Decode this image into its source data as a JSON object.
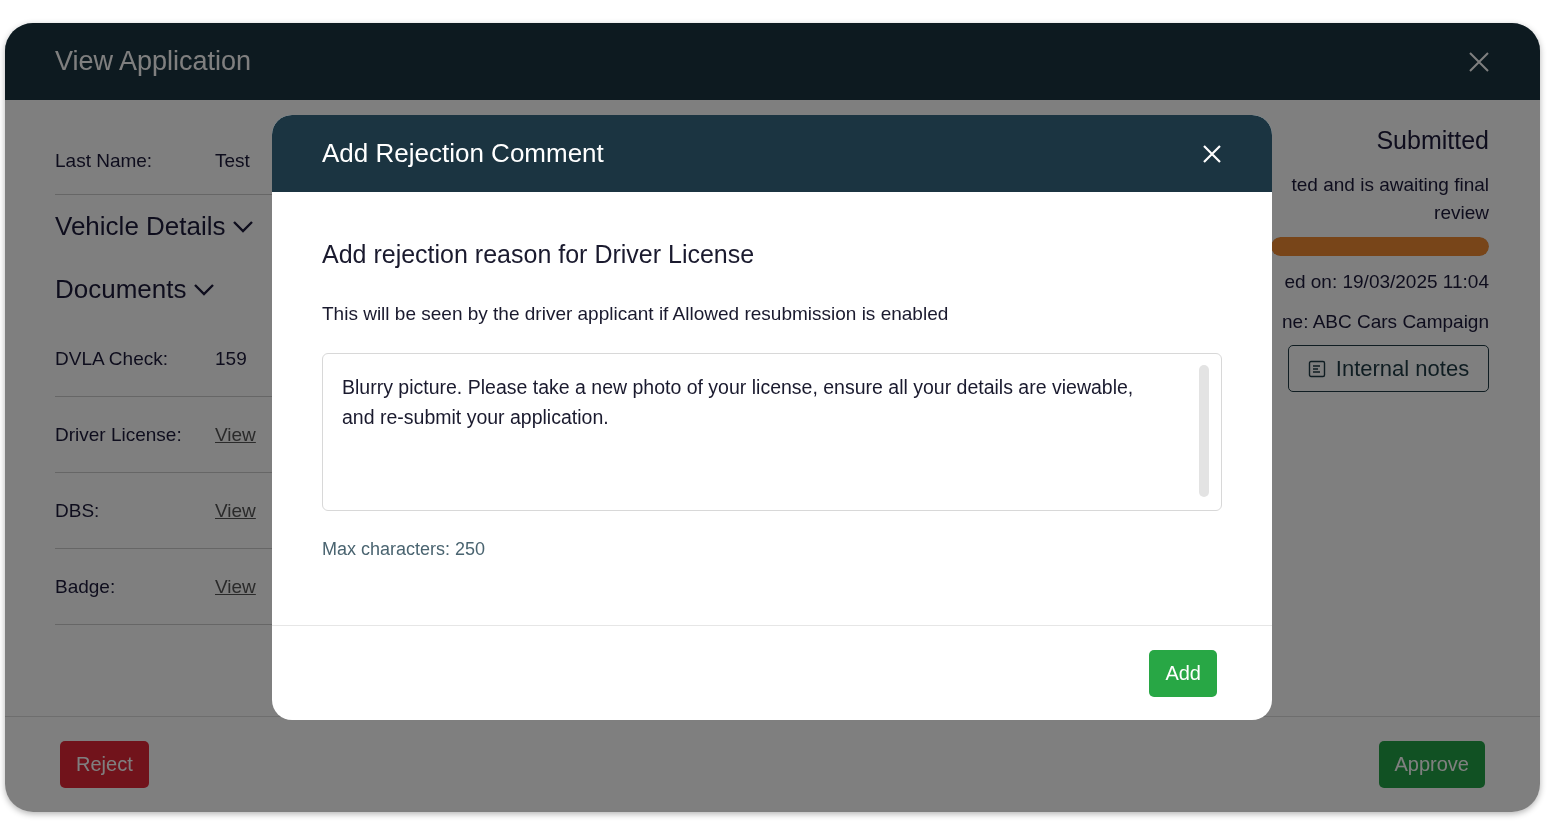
{
  "window": {
    "title": "View Application"
  },
  "details": [
    {
      "kind": "field",
      "label": "Last Name:",
      "value": "Test"
    },
    {
      "kind": "section",
      "label": "Vehicle Details"
    },
    {
      "kind": "section",
      "label": "Documents"
    },
    {
      "kind": "field",
      "label": "DVLA Check:",
      "value": "159"
    },
    {
      "kind": "link",
      "label": "Driver License:",
      "value": "View"
    },
    {
      "kind": "link",
      "label": "DBS:",
      "value": "View"
    },
    {
      "kind": "link",
      "label": "Badge:",
      "value": "View"
    }
  ],
  "status": {
    "title": "Submitted",
    "description": "ted and is awaiting final review",
    "level": 1,
    "submitted": "ed on: 19/03/2025 11:04",
    "campaign": "ne: ABC Cars Campaign",
    "notes_button": "Internal notes"
  },
  "footer": {
    "reject": "Reject",
    "approve": "Approve"
  },
  "modal": {
    "title": "Add Rejection Comment",
    "heading": "Add rejection reason for Driver License",
    "note": "This will be seen by the driver applicant if Allowed resubmission is enabled",
    "comment": "Blurry picture. Please take a new photo of your license, ensure all your details are viewable, and re-submit your application.",
    "limit": "Max characters: 250",
    "add_button": "Add"
  }
}
